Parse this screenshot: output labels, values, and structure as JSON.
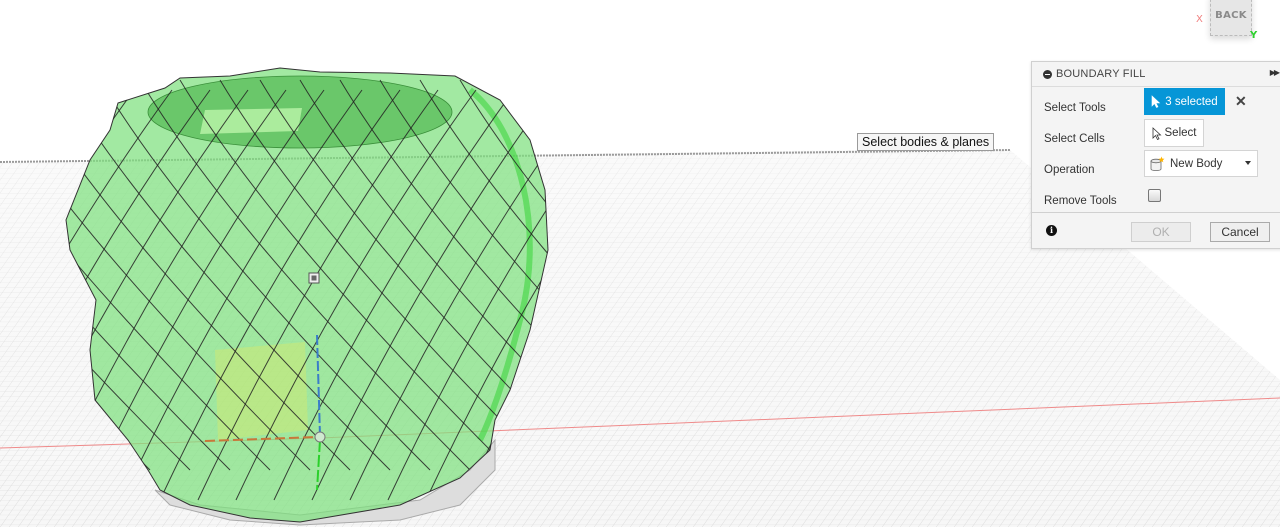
{
  "viewport": {
    "name": "3D modeling canvas",
    "viewcube": {
      "face_label": "BACK",
      "axis_x_label": "X",
      "axis_y_label": "Y"
    },
    "tooltip": "Select bodies & planes",
    "colors": {
      "body_fill": "#7ee07e",
      "body_edges": "#222222",
      "grid_line": "#c8c8c8",
      "x_axis": "#e8524f",
      "y_axis": "#2bd02b",
      "z_axis": "#3a7dc9"
    }
  },
  "dialog": {
    "title": "BOUNDARY FILL",
    "expand_icon": "fast-forward-icon",
    "rows": [
      {
        "label": "Select Tools",
        "control": "selection",
        "value": "3 selected",
        "clear_icon": "close-icon"
      },
      {
        "label": "Select Cells",
        "control": "selection",
        "value": "Select"
      },
      {
        "label": "Operation",
        "control": "dropdown",
        "value": "New Body"
      },
      {
        "label": "Remove Tools",
        "control": "checkbox",
        "checked": false
      }
    ],
    "footer": {
      "info_icon": "info-icon",
      "ok_label": "OK",
      "cancel_label": "Cancel",
      "ok_enabled": false
    },
    "accent_color": "#0696d7"
  }
}
